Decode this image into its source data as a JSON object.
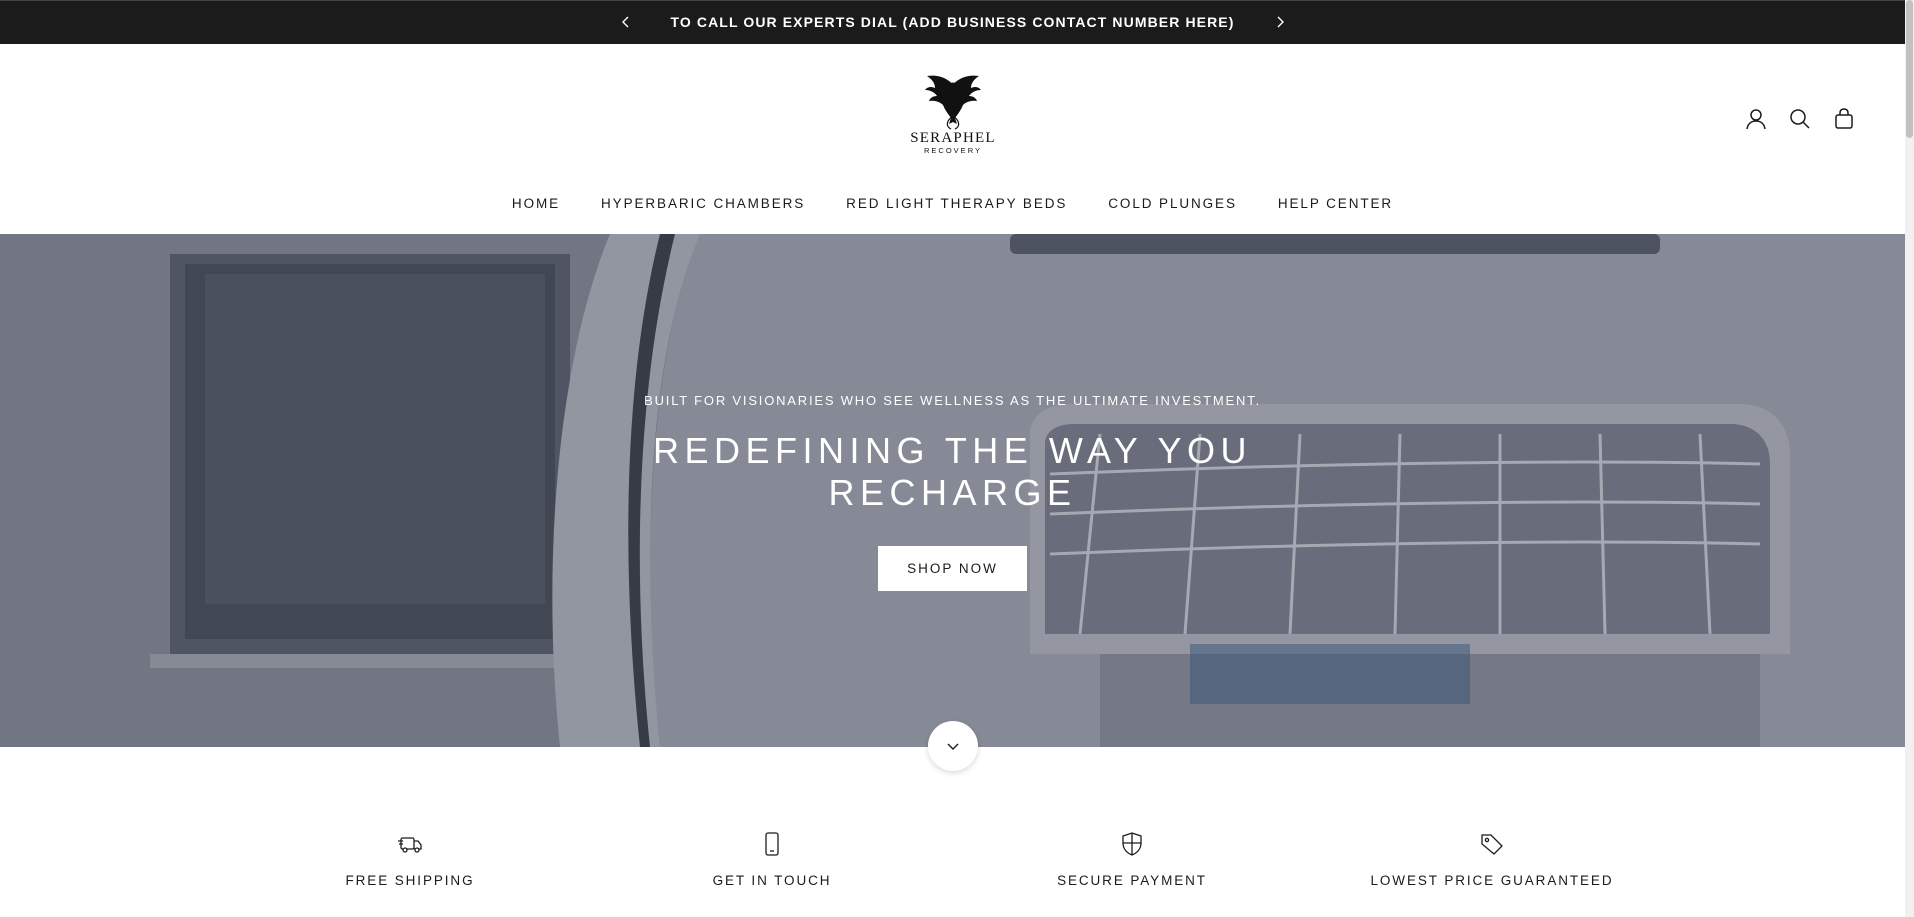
{
  "announcement": {
    "text": "TO CALL OUR EXPERTS DIAL (ADD BUSINESS CONTACT NUMBER HERE)",
    "prev_icon": "chevron-left-icon",
    "next_icon": "chevron-right-icon"
  },
  "header": {
    "logo_word": "SERAPHEL",
    "logo_sub": "RECOVERY",
    "logo_icon": "phoenix-icon",
    "icons": [
      "account-icon",
      "search-icon",
      "cart-icon"
    ]
  },
  "nav": {
    "items": [
      {
        "label": "HOME"
      },
      {
        "label": "HYPERBARIC CHAMBERS"
      },
      {
        "label": "RED LIGHT THERAPY BEDS"
      },
      {
        "label": "COLD PLUNGES"
      },
      {
        "label": "HELP CENTER"
      }
    ]
  },
  "hero": {
    "eyebrow": "BUILT FOR VISIONARIES WHO SEE WELLNESS AS THE ULTIMATE INVESTMENT.",
    "title": "REDEFINING THE WAY YOU RECHARGE",
    "button": "SHOP NOW",
    "scroll_icon": "chevron-down-icon"
  },
  "features": [
    {
      "label": "FREE SHIPPING",
      "icon": "truck-icon"
    },
    {
      "label": "GET IN TOUCH",
      "icon": "phone-icon"
    },
    {
      "label": "SECURE PAYMENT",
      "icon": "shield-icon"
    },
    {
      "label": "LOWEST PRICE GUARANTEED",
      "icon": "tag-icon"
    }
  ],
  "colors": {
    "announcement_bg": "#1c1b1b",
    "text": "#1c1b1b",
    "hero_overlay": "#7e8392",
    "button_bg": "#ffffff"
  }
}
